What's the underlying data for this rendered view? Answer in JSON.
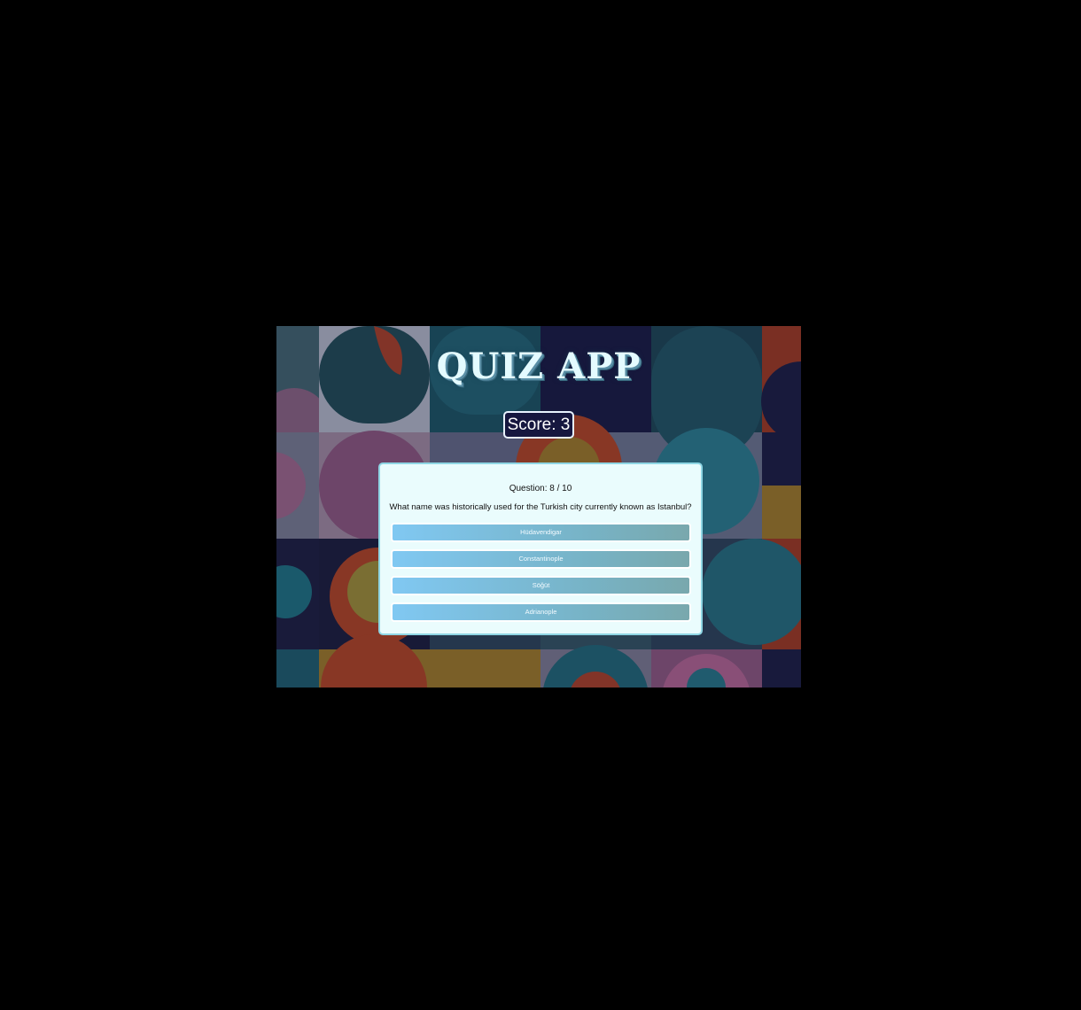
{
  "app": {
    "title": "QUIZ APP"
  },
  "score": {
    "text": "Score: 3"
  },
  "question": {
    "counter": "Question: 8 / 10",
    "text": "What name was historically used for the Turkish city currently known as Istanbul?"
  },
  "answers": [
    {
      "label": "Hüdavendigar"
    },
    {
      "label": "Constantinople"
    },
    {
      "label": "Söğüt"
    },
    {
      "label": "Adrianople"
    }
  ],
  "colors": {
    "page_background": "#000000",
    "title_text": "#e4fbff",
    "score_background": "#16173f",
    "card_background": "#eafcfd",
    "answer_gradient_start": "#80c8f2",
    "answer_gradient_end": "#79a8ad"
  }
}
